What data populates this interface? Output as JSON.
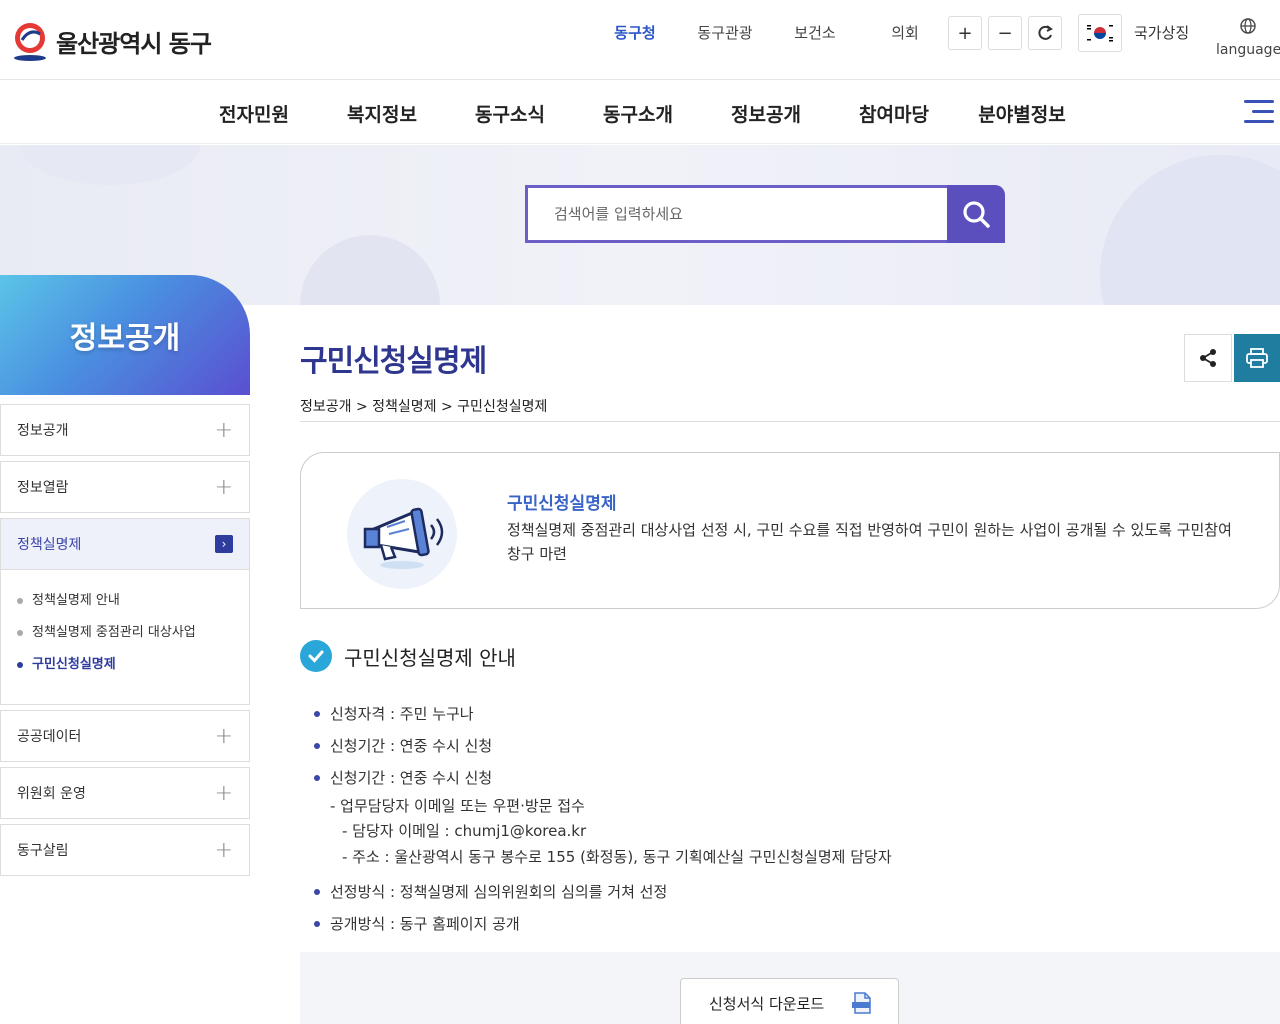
{
  "header": {
    "logo_text": "울산광역시 동구",
    "topnav": [
      "동구청",
      "동구관광",
      "보건소",
      "의회"
    ],
    "zoom_in": "+",
    "zoom_out": "−",
    "flag_label": "국가상징",
    "language_label": "language"
  },
  "gnb": [
    "전자민원",
    "복지정보",
    "동구소식",
    "동구소개",
    "정보공개",
    "참여마당",
    "분야별정보"
  ],
  "search": {
    "placeholder": "검색어를 입력하세요"
  },
  "sidebar": {
    "title": "정보공개",
    "items": [
      {
        "label": "정보공개"
      },
      {
        "label": "정보열람"
      },
      {
        "label": "정책실명제",
        "sub": [
          "정책실명제 안내",
          "정책실명제 중점관리 대상사업",
          "구민신청실명제"
        ]
      },
      {
        "label": "공공데이터"
      },
      {
        "label": "위원회 운영"
      },
      {
        "label": "동구살림"
      }
    ]
  },
  "content": {
    "title": "구민신청실명제",
    "breadcrumb": "정보공개 > 정책실명제 > 구민신청실명제",
    "intro_title": "구민신청실명제",
    "intro_desc": "정책실명제 중점관리 대상사업 선정 시, 구민 수요를 직접 반영하여 구민이 원하는 사업이 공개될 수 있도록 구민참여 창구 마련",
    "section_title": "구민신청실명제 안내",
    "info": {
      "qualify": "신청자격 : 주민 누구나",
      "period1": "신청기간 : 연중 수시 신청",
      "period2": "신청기간 : 연중 수시 신청",
      "method": "- 업무담당자 이메일 또는 우편·방문 접수",
      "email": "- 담당자 이메일 : chumj1@korea.kr",
      "address": "- 주소 : 울산광역시 동구 봉수로 155 (화정동), 동구 기획예산실 구민신청실명제 담당자",
      "select": "선정방식 : 정책실명제 심의위원회의 심의를 거쳐 선정",
      "publish": "공개방식 : 동구 홈페이지 공개"
    },
    "download_label": "신청서식 다운로드"
  }
}
